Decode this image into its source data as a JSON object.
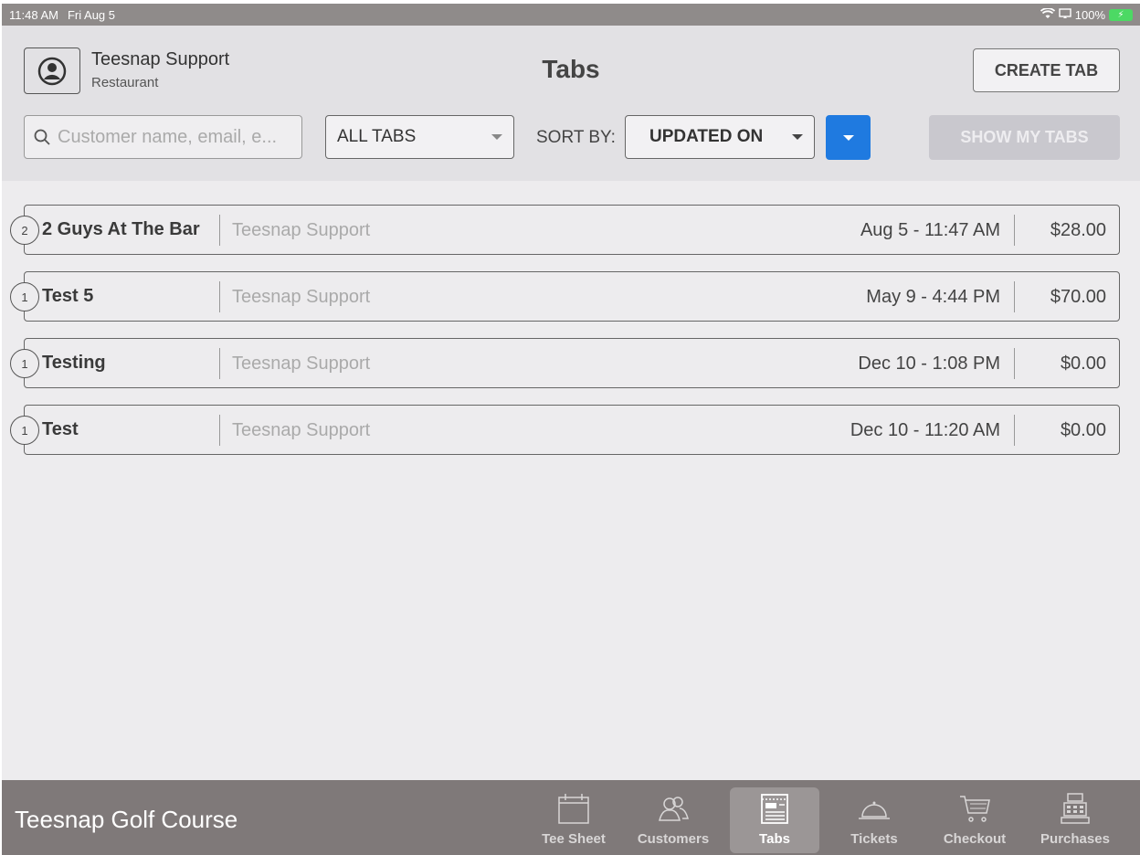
{
  "status_bar": {
    "time": "11:48 AM",
    "date": "Fri Aug 5",
    "battery": "100%"
  },
  "header": {
    "user_name": "Teesnap Support",
    "user_role": "Restaurant",
    "title": "Tabs",
    "create_label": "CREATE TAB"
  },
  "filters": {
    "search_placeholder": "Customer name, email, e...",
    "tab_filter": "ALL TABS",
    "sort_label": "SORT BY:",
    "sort_value": "UPDATED ON",
    "show_my_tabs_label": "SHOW MY TABS"
  },
  "tabs": [
    {
      "count": "2",
      "name": "2 Guys At The Bar",
      "owner": "Teesnap Support",
      "updated": "Aug 5 - 11:47 AM",
      "amount": "$28.00"
    },
    {
      "count": "1",
      "name": "Test 5",
      "owner": "Teesnap Support",
      "updated": "May 9 - 4:44 PM",
      "amount": "$70.00"
    },
    {
      "count": "1",
      "name": "Testing",
      "owner": "Teesnap Support",
      "updated": "Dec 10 - 1:08 PM",
      "amount": "$0.00"
    },
    {
      "count": "1",
      "name": "Test",
      "owner": "Teesnap Support",
      "updated": "Dec 10 - 11:20 AM",
      "amount": "$0.00"
    }
  ],
  "tab_bar": {
    "course_name": "Teesnap Golf Course",
    "items": [
      {
        "label": "Tee Sheet",
        "icon": "calendar-icon"
      },
      {
        "label": "Customers",
        "icon": "customers-icon"
      },
      {
        "label": "Tabs",
        "icon": "tabs-icon"
      },
      {
        "label": "Tickets",
        "icon": "cloche-icon"
      },
      {
        "label": "Checkout",
        "icon": "cart-icon"
      },
      {
        "label": "Purchases",
        "icon": "register-icon"
      }
    ],
    "active": "Tabs"
  },
  "colors": {
    "accent": "#1f7ae0",
    "tab_bar": "#7f7979",
    "status_bar": "#8f8b8a"
  }
}
